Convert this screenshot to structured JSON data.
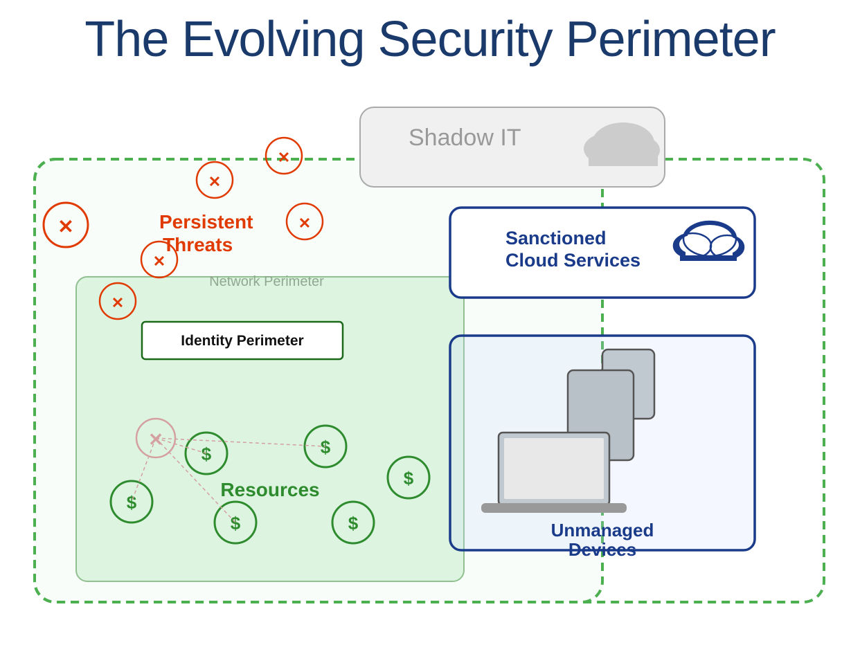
{
  "title": "The Evolving Security Perimeter",
  "threats": {
    "label_line1": "Persistent",
    "label_line2": "Threats",
    "icon": "✕"
  },
  "identity_perimeter": {
    "label": "Identity Perimeter"
  },
  "network_perimeter": {
    "label": "Network Perimeter"
  },
  "shadow_it": {
    "label": "Shadow IT"
  },
  "sanctioned_cloud": {
    "label_line1": "Sanctioned",
    "label_line2": "Cloud Services"
  },
  "unmanaged_devices": {
    "label_line1": "Unmanaged",
    "label_line2": "Devices"
  },
  "resources": {
    "label": "Resources",
    "symbol": "$"
  }
}
